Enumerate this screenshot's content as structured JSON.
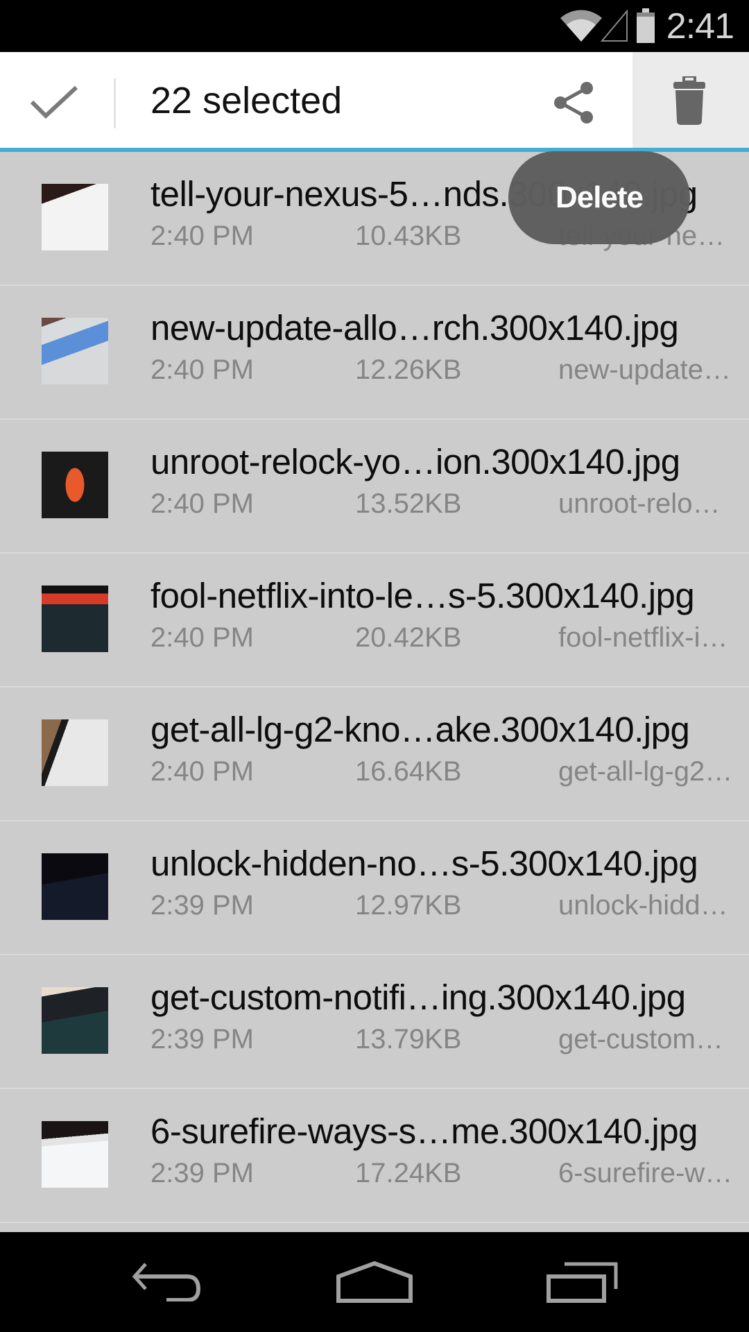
{
  "status_bar": {
    "time": "2:41",
    "icons": [
      "wifi-icon",
      "cell-signal-icon",
      "battery-icon"
    ]
  },
  "action_bar": {
    "done_icon": "checkmark-icon",
    "title": "22 selected",
    "share_icon": "share-icon",
    "delete_icon": "trash-icon",
    "accent_color": "#45acd3"
  },
  "toast": {
    "label": "Delete"
  },
  "files": [
    {
      "name": "tell-your-nexus-5…nds.300x140.jpg",
      "time": "2:40 PM",
      "size": "10.43KB",
      "short": "tell-your-ne…",
      "thumb": "google-now-screen"
    },
    {
      "name": "new-update-allo…rch.300x140.jpg",
      "time": "2:40 PM",
      "size": "12.26KB",
      "short": "new-update…",
      "thumb": "opening-app-screen"
    },
    {
      "name": "unroot-relock-yo…ion.300x140.jpg",
      "time": "2:40 PM",
      "size": "13.52KB",
      "short": "unroot-relo…",
      "thumb": "nexus-5-phone"
    },
    {
      "name": "fool-netflix-into-le…s-5.300x140.jpg",
      "time": "2:40 PM",
      "size": "20.42KB",
      "short": "fool-netflix-i…",
      "thumb": "netflix-homeland"
    },
    {
      "name": "get-all-lg-g2-kno…ake.300x140.jpg",
      "time": "2:40 PM",
      "size": "16.64KB",
      "short": "get-all-lg-g2…",
      "thumb": "phone-settings"
    },
    {
      "name": "unlock-hidden-no…s-5.300x140.jpg",
      "time": "2:39 PM",
      "size": "12.97KB",
      "short": "unlock-hidd…",
      "thumb": "notifications-screen"
    },
    {
      "name": "get-custom-notifi…ing.300x140.jpg",
      "time": "2:39 PM",
      "size": "13.79KB",
      "short": "get-custom…",
      "thumb": "wonderhowto-screen"
    },
    {
      "name": "6-surefire-ways-s…me.300x140.jpg",
      "time": "2:39 PM",
      "size": "17.24KB",
      "short": "6-surefire-w…",
      "thumb": "chrome-flags-screen"
    }
  ],
  "nav_bar": {
    "back_icon": "back-icon",
    "home_icon": "home-icon",
    "recents_icon": "recent-apps-icon"
  }
}
